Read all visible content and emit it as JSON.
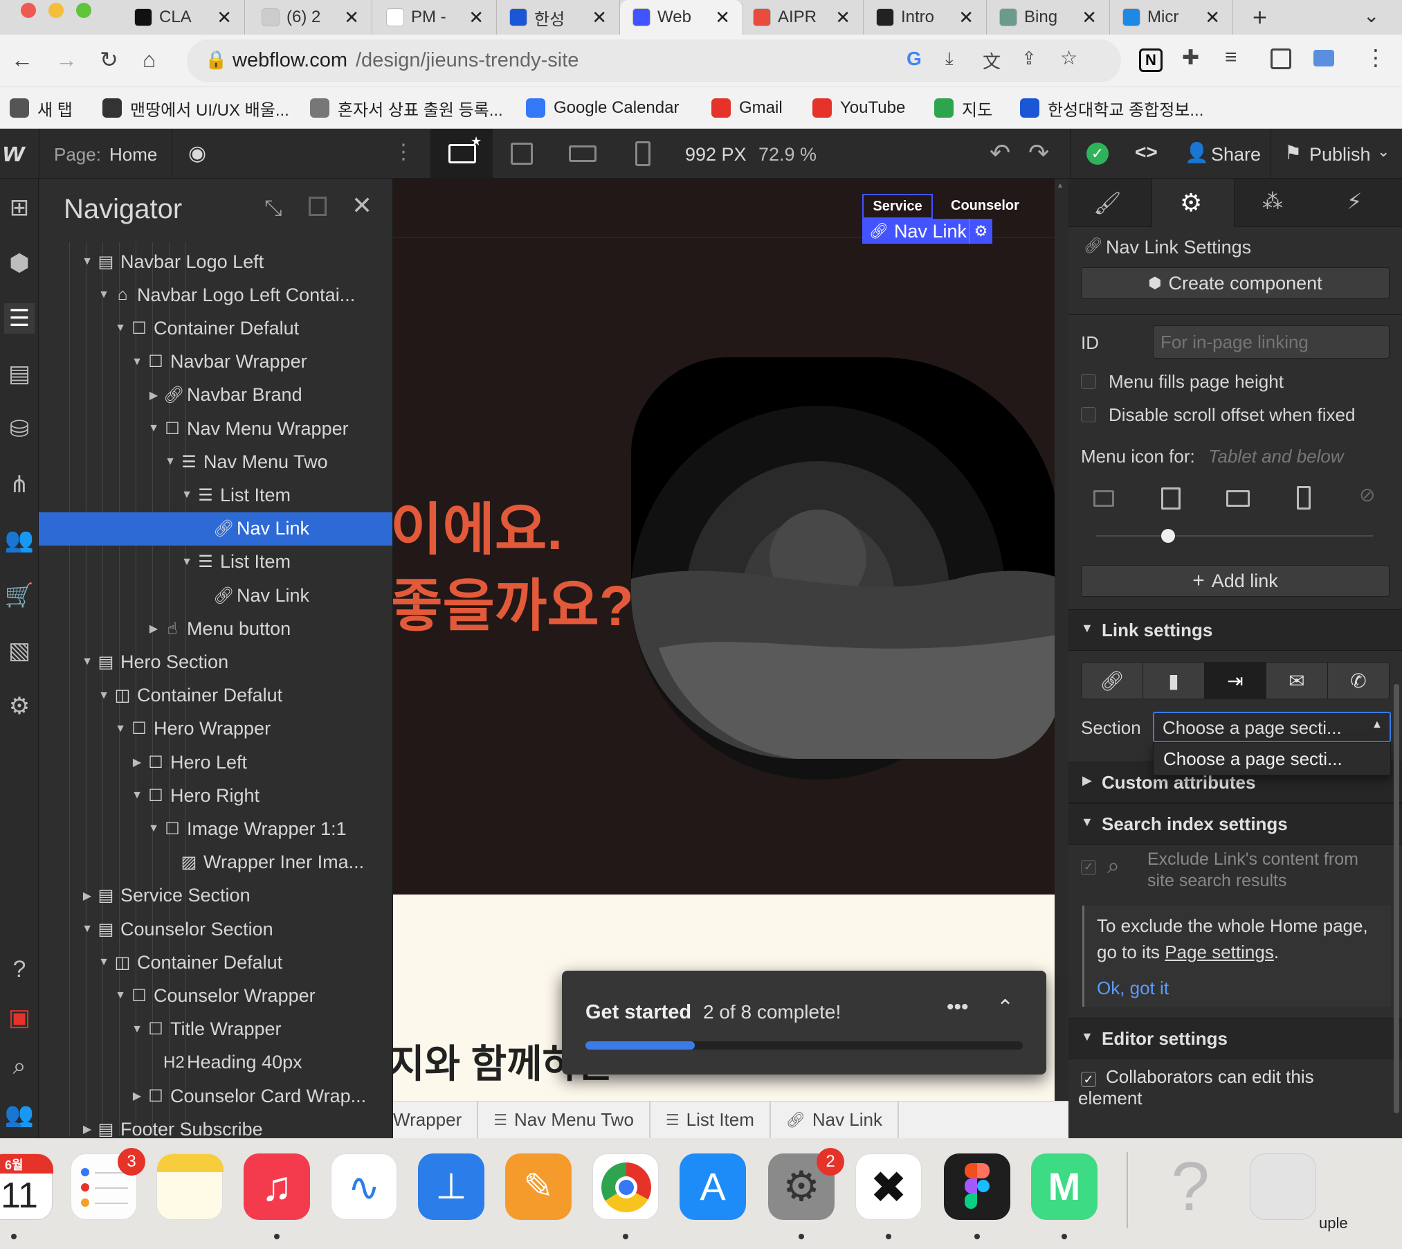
{
  "browser": {
    "tabs": [
      {
        "label": "CLA",
        "color": "#111111"
      },
      {
        "label": "(6) 2",
        "color": "#cccccc"
      },
      {
        "label": "PM -",
        "color": "#ffffff"
      },
      {
        "label": "한성",
        "color": "#1a57d6"
      },
      {
        "label": "Web",
        "color": "#4353ff"
      },
      {
        "label": "AIPR",
        "color": "#e94b3c"
      },
      {
        "label": "Intro",
        "color": "#222222"
      },
      {
        "label": "Bing",
        "color": "#6b9a8e"
      },
      {
        "label": "Micr",
        "color": "#1e88e5"
      }
    ],
    "url_host": "webflow.com",
    "url_path": "/design/jieuns-trendy-site",
    "bookmarks": [
      "새 탭",
      "맨땅에서 UI/UX 배울...",
      "혼자서 상표 출원 등록...",
      "Google Calendar",
      "Gmail",
      "YouTube",
      "지도",
      "한성대학교 종합정보..."
    ]
  },
  "designer": {
    "page_label": "Page:",
    "page_name": "Home",
    "width_px": "992 PX",
    "zoom": "72.9 %",
    "share": "Share",
    "publish": "Publish",
    "accent": "#4353ff"
  },
  "navigator": {
    "title": "Navigator",
    "rows": [
      {
        "label": "Navbar Logo Left",
        "icon": "section-icon",
        "depth": 0,
        "caret": "down"
      },
      {
        "label": "Navbar Logo Left Contai...",
        "icon": "home-icon",
        "depth": 1,
        "caret": "down"
      },
      {
        "label": "Container Defalut",
        "icon": "div-icon",
        "depth": 2,
        "caret": "down"
      },
      {
        "label": "Navbar Wrapper",
        "icon": "div-icon",
        "depth": 3,
        "caret": "down"
      },
      {
        "label": "Navbar Brand",
        "icon": "link-icon",
        "depth": 4,
        "caret": "right"
      },
      {
        "label": "Nav Menu Wrapper",
        "icon": "div-icon",
        "depth": 4,
        "caret": "down"
      },
      {
        "label": "Nav Menu Two",
        "icon": "list-icon",
        "depth": 5,
        "caret": "down"
      },
      {
        "label": "List Item",
        "icon": "list-icon",
        "depth": 6,
        "caret": "down"
      },
      {
        "label": "Nav Link",
        "icon": "link-icon",
        "depth": 7,
        "caret": "",
        "selected": true
      },
      {
        "label": "List Item",
        "icon": "list-icon",
        "depth": 6,
        "caret": "down"
      },
      {
        "label": "Nav Link",
        "icon": "link-icon",
        "depth": 7,
        "caret": ""
      },
      {
        "label": "Menu button",
        "icon": "hand-icon",
        "depth": 4,
        "caret": "right"
      },
      {
        "label": "Hero Section",
        "icon": "section-icon",
        "depth": 0,
        "caret": "down"
      },
      {
        "label": "Container Defalut",
        "icon": "container-icon",
        "depth": 1,
        "caret": "down"
      },
      {
        "label": "Hero Wrapper",
        "icon": "div-icon",
        "depth": 2,
        "caret": "down"
      },
      {
        "label": "Hero Left",
        "icon": "div-icon",
        "depth": 3,
        "caret": "right"
      },
      {
        "label": "Hero Right",
        "icon": "div-icon",
        "depth": 3,
        "caret": "down"
      },
      {
        "label": "Image Wrapper 1:1",
        "icon": "div-icon",
        "depth": 4,
        "caret": "down"
      },
      {
        "label": "Wrapper Iner Ima...",
        "icon": "image-icon",
        "depth": 5,
        "caret": ""
      },
      {
        "label": "Service Section",
        "icon": "section-icon",
        "depth": 0,
        "caret": "right"
      },
      {
        "label": "Counselor Section",
        "icon": "section-icon",
        "depth": 0,
        "caret": "down"
      },
      {
        "label": "Container Defalut",
        "icon": "container-icon",
        "depth": 1,
        "caret": "down"
      },
      {
        "label": "Counselor Wrapper",
        "icon": "div-icon",
        "depth": 2,
        "caret": "down"
      },
      {
        "label": "Title Wrapper",
        "icon": "div-icon",
        "depth": 3,
        "caret": "down"
      },
      {
        "label": "Heading 40px",
        "icon": "heading-icon",
        "depth": 4,
        "caret": ""
      },
      {
        "label": "Counselor Card Wrap...",
        "icon": "div-icon",
        "depth": 3,
        "caret": "right"
      },
      {
        "label": "Footer Subscribe",
        "icon": "section-icon",
        "depth": 0,
        "caret": "right"
      }
    ]
  },
  "canvas": {
    "nav_service": "Service",
    "nav_counselor": "Counselor",
    "selected_tag": "Nav Link",
    "hero_line1": "이에요.",
    "hero_line2": "좋을까요?",
    "lower_heading": "지와 함께하는",
    "hero_color": "#e25a3a"
  },
  "getstarted": {
    "title": "Get started",
    "status": "2 of 8 complete!",
    "progress": 0.25
  },
  "breadcrumb": [
    "Wrapper",
    "Nav Menu Two",
    "List Item",
    "Nav Link"
  ],
  "settings": {
    "header": "Nav Link Settings",
    "create_component": "Create component",
    "id_label": "ID",
    "id_placeholder": "For in-page linking",
    "menu_fills": "Menu fills page height",
    "disable_scroll": "Disable scroll offset when fixed",
    "menu_icon_label": "Menu icon for:",
    "menu_icon_value": "Tablet and below",
    "add_link": "Add link",
    "link_settings": "Link settings",
    "section_label": "Section",
    "section_value": "Choose a page secti...",
    "dropdown_option": "Choose a page secti...",
    "custom_attributes": "Custom attributes",
    "search_index": "Search index settings",
    "exclude_text": "Exclude Link's content from site search results",
    "info_text_before": "To exclude the whole Home page, go to its ",
    "info_link": "Page settings",
    "info_text_after": ".",
    "ok_got_it": "Ok, got it",
    "editor_settings": "Editor settings",
    "collaborators": "Collaborators can edit this element"
  },
  "dock": {
    "calendar_month": "6월",
    "calendar_day": "11",
    "reminders_badge": "3",
    "settings_badge": "2",
    "trash_label": "uple"
  }
}
